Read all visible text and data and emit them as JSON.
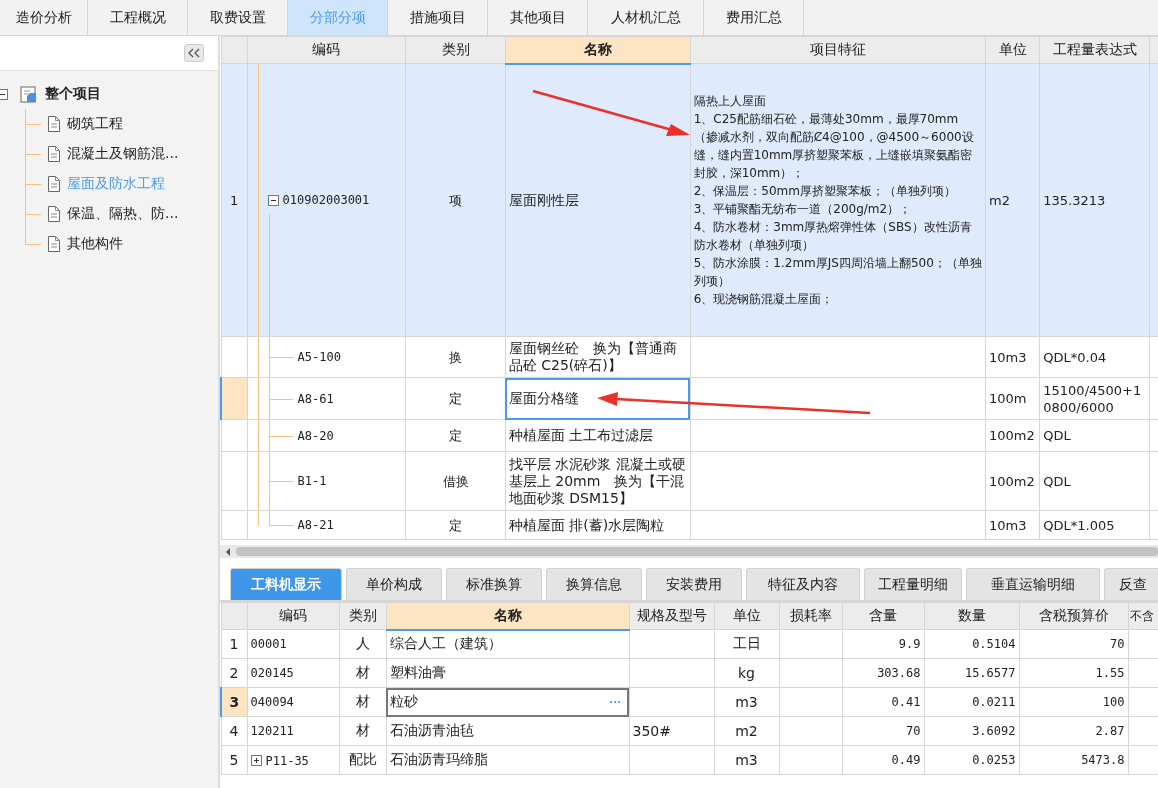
{
  "top_tabs": [
    {
      "label": "造价分析",
      "selected": false
    },
    {
      "label": "工程概况",
      "selected": false
    },
    {
      "label": "取费设置",
      "selected": false
    },
    {
      "label": "分部分项",
      "selected": true
    },
    {
      "label": "措施项目",
      "selected": false
    },
    {
      "label": "其他项目",
      "selected": false
    },
    {
      "label": "人材机汇总",
      "selected": false
    },
    {
      "label": "费用汇总",
      "selected": false
    }
  ],
  "sidebar": {
    "tree": {
      "label": "整个项目",
      "expanded": true,
      "children": [
        {
          "label": "砌筑工程",
          "selected": false
        },
        {
          "label": "混凝土及钢筋混...",
          "selected": false
        },
        {
          "label": "屋面及防水工程",
          "selected": true
        },
        {
          "label": "保温、隔热、防...",
          "selected": false
        },
        {
          "label": "其他构件",
          "selected": false
        }
      ]
    }
  },
  "upper_table": {
    "columns": [
      {
        "label": "编码",
        "current": false
      },
      {
        "label": "类别",
        "current": false
      },
      {
        "label": "名称",
        "current": true
      },
      {
        "label": "项目特征",
        "current": false
      },
      {
        "label": "单位",
        "current": false
      },
      {
        "label": "工程量表达式",
        "current": false
      }
    ],
    "rows": [
      {
        "kind": "parent",
        "expanded": true,
        "number": "1",
        "code": "010902003001",
        "type": "项",
        "name": "屋面刚性层",
        "feature": "隔热上人屋面\n1、C25配筋细石砼，最薄处30mm，最厚70mm（掺减水剂，双向配筋Ȼ4@100，@4500～6000设缝，缝内置10mm厚挤塑聚苯板，上缝嵌填聚氨酯密封胶，深10mm）；\n2、保温层：50mm厚挤塑聚苯板；（单独列项）\n3、平铺聚酯无纺布一道（200g/m2）；\n4、防水卷材：3mm厚热熔弹性体（SBS）改性沥青防水卷材（单独列项）\n5、防水涂膜：1.2mm厚JS四周沿墙上翻500；（单独列项）\n6、现浇钢筋混凝土屋面；",
        "unit": "m2",
        "expression": "135.3213",
        "selected": true,
        "current": false
      },
      {
        "kind": "child",
        "code": "A5-100",
        "type": "换",
        "name": "屋面钢丝砼　换为【普通商品砼 C25(碎石)】",
        "unit": "10m3",
        "expression": "QDL*0.04",
        "selected": false,
        "current": false
      },
      {
        "kind": "child",
        "code": "A8-61",
        "type": "定",
        "name": "屋面分格缝",
        "unit": "100m",
        "expression": "15100/4500+10800/6000",
        "selected": false,
        "current": true
      },
      {
        "kind": "child",
        "code": "A8-20",
        "type": "定",
        "name": "种植屋面 土工布过滤层",
        "unit": "100m2",
        "expression": "QDL",
        "selected": false,
        "current": false
      },
      {
        "kind": "child",
        "code": "B1-1",
        "type": "借换",
        "name": "找平层 水泥砂浆 混凝土或硬基层上 20mm　换为【干混地面砂浆 DSM15】",
        "unit": "100m2",
        "expression": "QDL",
        "selected": false,
        "current": false
      },
      {
        "kind": "child",
        "code": "A8-21",
        "type": "定",
        "name": "种植屋面 排(蓄)水层陶粒",
        "unit": "10m3",
        "expression": "QDL*1.005",
        "selected": false,
        "current": false
      }
    ]
  },
  "lower_tabs": [
    {
      "label": "工料机显示",
      "selected": true
    },
    {
      "label": "单价构成",
      "selected": false
    },
    {
      "label": "标准换算",
      "selected": false
    },
    {
      "label": "换算信息",
      "selected": false
    },
    {
      "label": "安装费用",
      "selected": false
    },
    {
      "label": "特征及内容",
      "selected": false
    },
    {
      "label": "工程量明细",
      "selected": false
    },
    {
      "label": "垂直运输明细",
      "selected": false
    },
    {
      "label": "反查",
      "selected": false
    }
  ],
  "lower_table": {
    "columns": [
      {
        "label": "编码",
        "current": false
      },
      {
        "label": "类别",
        "current": false
      },
      {
        "label": "名称",
        "current": true
      },
      {
        "label": "规格及型号",
        "current": false
      },
      {
        "label": "单位",
        "current": false
      },
      {
        "label": "损耗率",
        "current": false
      },
      {
        "label": "含量",
        "current": false
      },
      {
        "label": "数量",
        "current": false
      },
      {
        "label": "含税预算价",
        "current": false
      },
      {
        "label": "不含",
        "current": false
      }
    ],
    "rows": [
      {
        "kind": "material",
        "number": "1",
        "code": "00001",
        "type": "人",
        "name": "综合人工（建筑）",
        "unit": "工日",
        "content": "9.9",
        "quantity": "0.5104",
        "price": "70",
        "current": false
      },
      {
        "kind": "material",
        "number": "2",
        "code": "020145",
        "type": "材",
        "name": "塑料油膏",
        "unit": "kg",
        "content": "303.68",
        "quantity": "15.6577",
        "price": "1.55",
        "current": false
      },
      {
        "kind": "material",
        "number": "3",
        "code": "040094",
        "type": "材",
        "name": "粒砂",
        "edit_button": "···",
        "unit": "m3",
        "content": "0.41",
        "quantity": "0.0211",
        "price": "100",
        "current": true
      },
      {
        "kind": "material",
        "number": "4",
        "code": "120211",
        "type": "材",
        "name": "石油沥青油毡",
        "spec": "350#",
        "unit": "m2",
        "content": "70",
        "quantity": "3.6092",
        "price": "2.87",
        "current": false
      },
      {
        "kind": "mix",
        "expanded": false,
        "number": "5",
        "code": "P11-35",
        "type": "配比",
        "name": "石油沥青玛缔脂",
        "unit": "m3",
        "content": "0.49",
        "quantity": "0.0253",
        "price": "5473.8",
        "current": false
      }
    ]
  }
}
